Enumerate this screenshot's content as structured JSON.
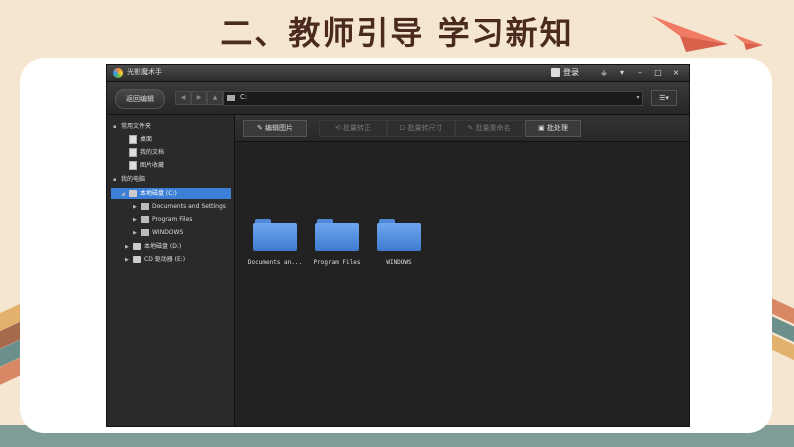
{
  "slide": {
    "title": "二、教师引导 学习新知"
  },
  "app": {
    "title": "光影魔术手",
    "login_label": "登录",
    "window_buttons": [
      "⚶",
      "▾",
      "–",
      "□",
      "×"
    ],
    "back_button": "返回编辑",
    "nav_buttons": [
      "◀",
      "▶",
      "▲"
    ],
    "path": "C:",
    "view_button": "☰▾"
  },
  "sidebar": {
    "favorites": "常用文件夹",
    "desktop": "桌面",
    "my_docs": "我的文档",
    "pictures": "图片收藏",
    "my_computer": "我的电脑",
    "drive_c": "本地磁盘 (C:)",
    "c_docs": "Documents and Settings",
    "c_program": "Program Files",
    "c_windows": "WINDOWS",
    "drive_d": "本地磁盘 (D:)",
    "drive_e": "CD 驱动器 (E:)"
  },
  "actions": {
    "edit": "编辑图片",
    "rotate": "批量转正",
    "resize": "批量转尺寸",
    "rename": "批量重命名",
    "batch": "批处理"
  },
  "folders": [
    {
      "label": "Documents an..."
    },
    {
      "label": "Program Files"
    },
    {
      "label": "WINDOWS"
    }
  ],
  "colors": {
    "selected": "#3b7fd6",
    "folder": "#5b95e2",
    "title_text": "#4b2b1f"
  }
}
